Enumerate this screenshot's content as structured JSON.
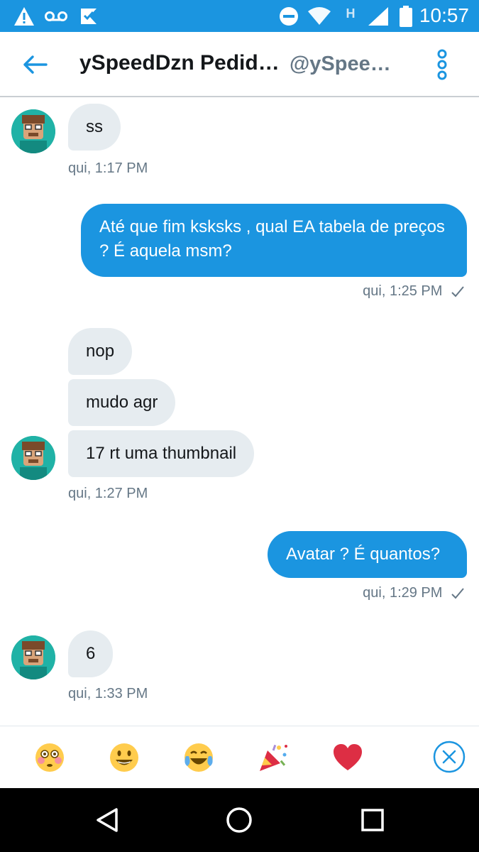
{
  "status_bar": {
    "time": "10:57",
    "network_label": "H",
    "icons": [
      "warning-icon",
      "voicemail-icon",
      "app-notification-icon",
      "do-not-disturb-icon",
      "wifi-icon",
      "signal-icon",
      "battery-icon"
    ]
  },
  "header": {
    "title": "ySpeedDzn Pedid…",
    "handle": "@ySpee…",
    "back_icon": "back-arrow-icon",
    "more_icon": "more-vertical-icon"
  },
  "messages": [
    {
      "direction": "in",
      "bubbles": [
        "ss"
      ],
      "timestamp": "qui, 1:17 PM"
    },
    {
      "direction": "out",
      "bubbles": [
        "Até que fim ksksks , qual EA tabela de preços ? É aquela msm?"
      ],
      "timestamp": "qui, 1:25 PM",
      "status": "sent"
    },
    {
      "direction": "in",
      "bubbles": [
        "nop",
        "mudo agr",
        "17 rt uma thumbnail"
      ],
      "timestamp": "qui, 1:27 PM"
    },
    {
      "direction": "out",
      "bubbles": [
        "Avatar ? É quantos?"
      ],
      "timestamp": "qui, 1:29 PM",
      "status": "sent"
    },
    {
      "direction": "in",
      "bubbles": [
        "6"
      ],
      "timestamp": "qui, 1:33 PM"
    }
  ],
  "reactions": [
    "flushed-face-icon",
    "smiley-face-icon",
    "tears-of-joy-icon",
    "party-popper-icon",
    "red-heart-icon"
  ],
  "navigation": [
    "back-triangle-icon",
    "home-circle-icon",
    "recents-square-icon"
  ],
  "colors": {
    "accent": "#1b95e0",
    "incoming_bubble": "#e6ecf0",
    "secondary_text": "#657786",
    "heart": "#e0245e"
  }
}
